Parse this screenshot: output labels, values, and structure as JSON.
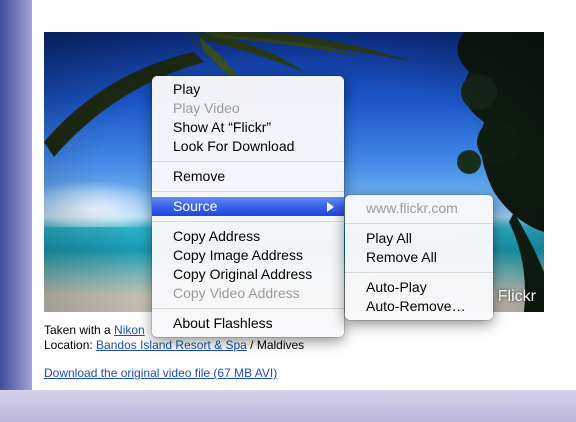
{
  "photo": {
    "credit": "Flickr"
  },
  "caption": {
    "taken_prefix": "Taken with a",
    "camera_link": "Nikon",
    "location_prefix": "Location:",
    "location_link": "Bandos Island Resort & Spa",
    "location_suffix": "/ Maldives"
  },
  "download_link": "Download the original video file (67 MB AVI)",
  "context_menu": {
    "items": [
      {
        "label": "Play",
        "enabled": true
      },
      {
        "label": "Play Video",
        "enabled": false
      },
      {
        "label": "Show At “Flickr”",
        "enabled": true
      },
      {
        "label": "Look For Download",
        "enabled": true
      },
      {
        "label": "Remove",
        "enabled": true
      },
      {
        "label": "Source",
        "enabled": true,
        "highlighted": true,
        "has_submenu": true
      },
      {
        "label": "Copy Address",
        "enabled": true
      },
      {
        "label": "Copy Image Address",
        "enabled": true
      },
      {
        "label": "Copy Original Address",
        "enabled": true
      },
      {
        "label": "Copy Video Address",
        "enabled": false
      },
      {
        "label": "About Flashless",
        "enabled": true
      }
    ]
  },
  "submenu": {
    "items": [
      {
        "label": "www.flickr.com",
        "enabled": false
      },
      {
        "label": "Play All",
        "enabled": true
      },
      {
        "label": "Remove All",
        "enabled": true
      },
      {
        "label": "Auto-Play",
        "enabled": true
      },
      {
        "label": "Auto-Remove…",
        "enabled": true
      }
    ]
  },
  "colors": {
    "highlight": "#3a62ea",
    "link": "#1a4fb3",
    "disabled_text": "#9a9a9a"
  }
}
